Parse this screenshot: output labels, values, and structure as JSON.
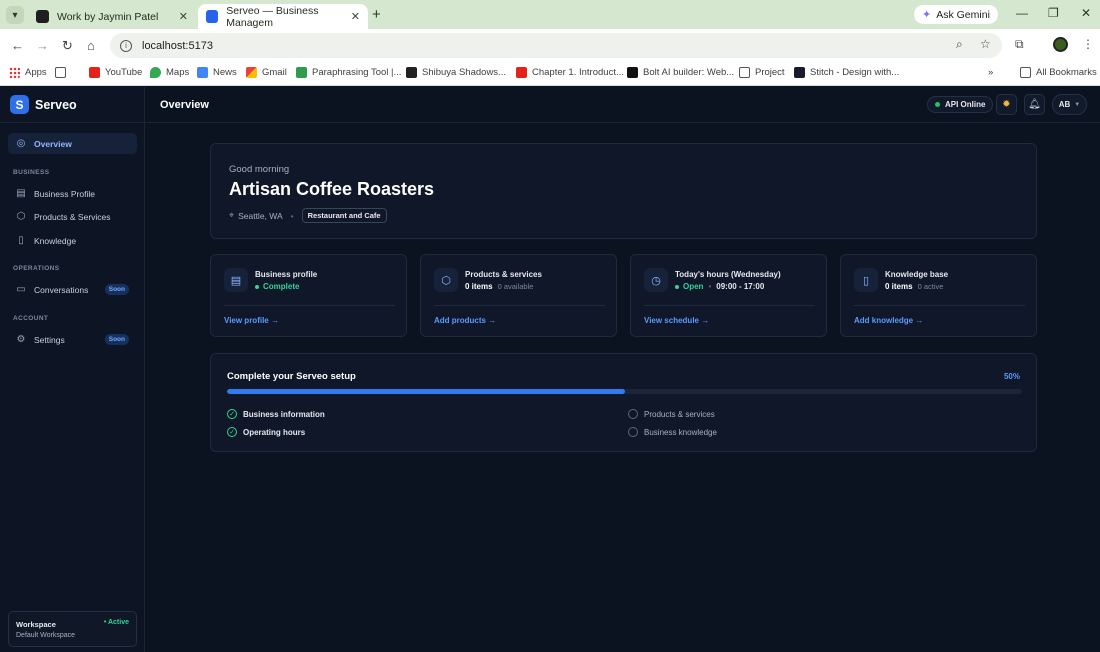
{
  "browser": {
    "tabs": [
      {
        "title": "Work by Jaymin Patel"
      },
      {
        "title": "Serveo — Business Managem"
      }
    ],
    "ask_gemini": "Ask Gemini",
    "url": "localhost:5173",
    "bookmarks": [
      {
        "label": "Apps"
      },
      {
        "label": ""
      },
      {
        "label": "YouTube"
      },
      {
        "label": "Maps"
      },
      {
        "label": "News"
      },
      {
        "label": "Gmail"
      },
      {
        "label": "Paraphrasing Tool |..."
      },
      {
        "label": "Shibuya Shadows..."
      },
      {
        "label": "Chapter 1. Introduct..."
      },
      {
        "label": "Bolt AI builder: Web..."
      },
      {
        "label": "Project"
      },
      {
        "label": "Stitch - Design with..."
      }
    ],
    "all_bookmarks": "All Bookmarks"
  },
  "app": {
    "brand": "Serveo",
    "page_title": "Overview",
    "api_status": "API Online",
    "user_initials": "AB",
    "nav": {
      "overview": "Overview",
      "section_business": "BUSINESS",
      "business_profile": "Business Profile",
      "products_services": "Products & Services",
      "knowledge": "Knowledge",
      "section_operations": "OPERATIONS",
      "conversations": "Conversations",
      "section_account": "ACCOUNT",
      "settings": "Settings",
      "soon": "Soon"
    },
    "workspace": {
      "title": "Workspace",
      "name": "Default Workspace",
      "status": "• Active"
    }
  },
  "hero": {
    "greeting": "Good morning",
    "business_name": "Artisan Coffee Roasters",
    "location": "Seattle, WA",
    "category": "Restaurant and Cafe"
  },
  "stats": {
    "profile": {
      "title": "Business profile",
      "status": "Complete",
      "link": "View profile →"
    },
    "products": {
      "title": "Products & services",
      "count": "0 items",
      "extra": "0 available",
      "link": "Add products →"
    },
    "hours": {
      "title": "Today's hours (Wednesday)",
      "status": "Open",
      "range": "09:00 - 17:00",
      "link": "View schedule →"
    },
    "knowledge": {
      "title": "Knowledge base",
      "count": "0 items",
      "extra": "0 active",
      "link": "Add knowledge →"
    }
  },
  "setup": {
    "title": "Complete your Serveo setup",
    "percent_label": "50%",
    "progress": 0.5,
    "items": [
      {
        "label": "Business information",
        "done": true
      },
      {
        "label": "Operating hours",
        "done": true
      },
      {
        "label": "Products & services",
        "done": false
      },
      {
        "label": "Business knowledge",
        "done": false
      }
    ]
  },
  "colors": {
    "accent": "#2f7bf0",
    "success": "#34d399",
    "background": "#0b1220"
  }
}
